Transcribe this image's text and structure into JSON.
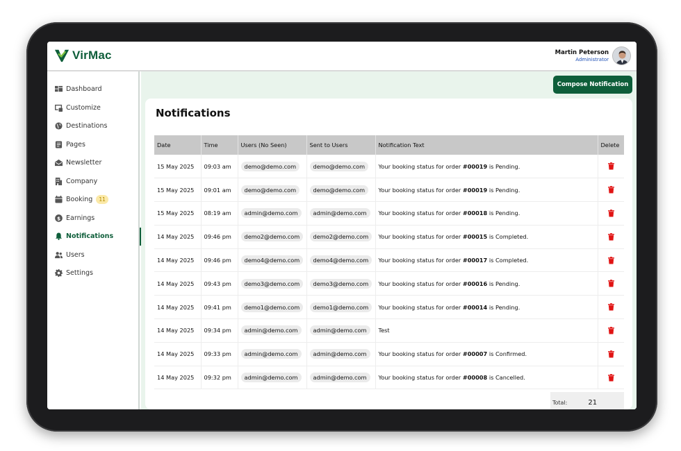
{
  "app": {
    "name": "VirMac"
  },
  "user": {
    "name": "Martin Peterson",
    "role": "Administrator"
  },
  "sidebar": {
    "items": [
      {
        "label": "Dashboard",
        "icon": "dashboard-icon"
      },
      {
        "label": "Customize",
        "icon": "customize-icon"
      },
      {
        "label": "Destinations",
        "icon": "globe-icon"
      },
      {
        "label": "Pages",
        "icon": "pages-icon"
      },
      {
        "label": "Newsletter",
        "icon": "newsletter-icon"
      },
      {
        "label": "Company",
        "icon": "building-icon"
      },
      {
        "label": "Booking",
        "icon": "booking-icon",
        "badge": "11"
      },
      {
        "label": "Earnings",
        "icon": "dollar-icon"
      },
      {
        "label": "Notifications",
        "icon": "bell-icon",
        "active": true
      },
      {
        "label": "Users",
        "icon": "users-icon"
      },
      {
        "label": "Settings",
        "icon": "gear-icon"
      }
    ]
  },
  "main": {
    "compose_label": "Compose Notification",
    "title": "Notifications",
    "columns": [
      "Date",
      "Time",
      "Users (No Seen)",
      "Sent to Users",
      "Notification Text",
      "Delete"
    ],
    "rows": [
      {
        "date": "15 May 2025",
        "time": "09:03 am",
        "unseen": "demo@demo.com",
        "sent": "demo@demo.com",
        "pre": "Your booking status for order ",
        "order": "#00019",
        "post": " is Pending."
      },
      {
        "date": "15 May 2025",
        "time": "09:01 am",
        "unseen": "demo@demo.com",
        "sent": "demo@demo.com",
        "pre": "Your booking status for order ",
        "order": "#00019",
        "post": " is Pending."
      },
      {
        "date": "15 May 2025",
        "time": "08:19 am",
        "unseen": "admin@demo.com",
        "sent": "admin@demo.com",
        "pre": "Your booking status for order ",
        "order": "#00018",
        "post": " is Pending."
      },
      {
        "date": "14 May 2025",
        "time": "09:46 pm",
        "unseen": "demo2@demo.com",
        "sent": "demo2@demo.com",
        "pre": "Your booking status for order ",
        "order": "#00015",
        "post": " is Completed."
      },
      {
        "date": "14 May 2025",
        "time": "09:46 pm",
        "unseen": "demo4@demo.com",
        "sent": "demo4@demo.com",
        "pre": "Your booking status for order ",
        "order": "#00017",
        "post": " is Completed."
      },
      {
        "date": "14 May 2025",
        "time": "09:43 pm",
        "unseen": "demo3@demo.com",
        "sent": "demo3@demo.com",
        "pre": "Your booking status for order ",
        "order": "#00016",
        "post": " is Pending."
      },
      {
        "date": "14 May 2025",
        "time": "09:41 pm",
        "unseen": "demo1@demo.com",
        "sent": "demo1@demo.com",
        "pre": "Your booking status for order ",
        "order": "#00014",
        "post": " is Pending."
      },
      {
        "date": "14 May 2025",
        "time": "09:34 pm",
        "unseen": "admin@demo.com",
        "sent": "admin@demo.com",
        "pre": "Test",
        "order": "",
        "post": ""
      },
      {
        "date": "14 May 2025",
        "time": "09:33 pm",
        "unseen": "admin@demo.com",
        "sent": "admin@demo.com",
        "pre": "Your booking status for order ",
        "order": "#00007",
        "post": " is Confirmed."
      },
      {
        "date": "14 May 2025",
        "time": "09:32 pm",
        "unseen": "admin@demo.com",
        "sent": "admin@demo.com",
        "pre": "Your booking status for order ",
        "order": "#00008",
        "post": " is Cancelled."
      }
    ],
    "total_label": "Total:",
    "total_value": "21"
  },
  "colors": {
    "brand": "#0e5e3a",
    "delete": "#e11414",
    "badge_bg": "#fbe9a8"
  }
}
